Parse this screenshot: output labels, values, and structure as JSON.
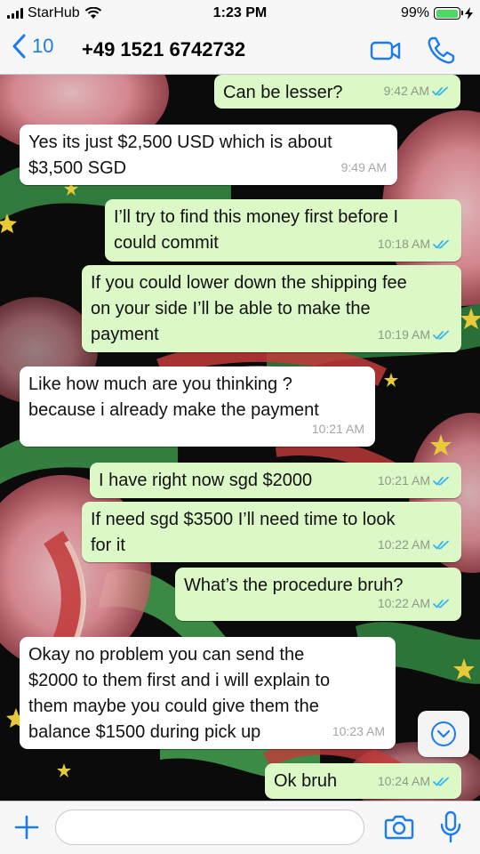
{
  "status_bar": {
    "carrier": "StarHub",
    "time": "1:23 PM",
    "battery": "99%",
    "battery_level": 0.99
  },
  "header": {
    "back_count": "10",
    "contact": "+49 1521 6742732"
  },
  "messages": [
    {
      "dir": "out",
      "text": "Can be lesser?",
      "time": "9:42 AM",
      "read": true
    },
    {
      "dir": "in",
      "text": "Yes its just $2,500 USD which is about\n$3,500 SGD",
      "time": "9:49 AM"
    },
    {
      "dir": "out",
      "text": "I’ll try to find this money first before I\ncould commit",
      "time": "10:18 AM",
      "read": true
    },
    {
      "dir": "out",
      "text": "If you could lower down the shipping fee\non your side I’ll be able to make the\npayment",
      "time": "10:19 AM",
      "read": true
    },
    {
      "dir": "in",
      "text": "Like how much are you thinking ?\nbecause i already make the payment",
      "time": "10:21 AM"
    },
    {
      "dir": "out",
      "text": "I have right now sgd $2000",
      "time": "10:21 AM",
      "read": true
    },
    {
      "dir": "out",
      "text": "If need sgd $3500 I’ll need time to look\nfor it",
      "time": "10:22 AM",
      "read": true
    },
    {
      "dir": "out",
      "text": "What’s the procedure bruh?",
      "time": "10:22 AM",
      "read": true
    },
    {
      "dir": "in",
      "text": "Okay no problem you can send the\n$2000 to them first and i will explain to\nthem maybe you could give them the\nbalance $1500 during pick up",
      "time": "10:23 AM"
    },
    {
      "dir": "out",
      "text": "Ok bruh",
      "time": "10:24 AM",
      "read": true
    }
  ],
  "input": {
    "placeholder": "",
    "value": ""
  },
  "colors": {
    "accent": "#1a7bf2",
    "outgoing_bubble": "#dcf8c6",
    "incoming_bubble": "#ffffff",
    "read_ticks": "#34b7f1",
    "wallpaper": "#0b0b0b"
  },
  "icons": {
    "back": "chevron-left-icon",
    "video_call": "video-camera-icon",
    "voice_call": "phone-icon",
    "scroll_down": "chevron-down-circle-icon",
    "attach": "plus-icon",
    "camera": "camera-icon",
    "microphone": "microphone-icon"
  }
}
